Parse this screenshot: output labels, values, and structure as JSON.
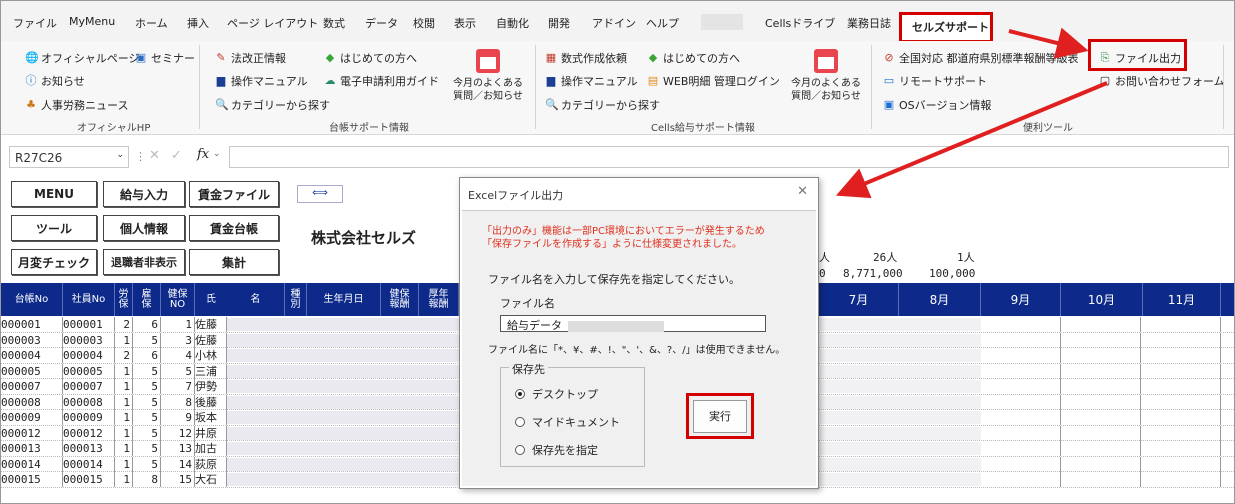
{
  "menu": {
    "tabs": [
      "ファイル",
      "MyMenu",
      "ホーム",
      "挿入",
      "ページ レイアウト",
      "数式",
      "データ",
      "校閲",
      "表示",
      "自動化",
      "開発",
      "アドイン",
      "ヘルプ",
      "Cellsドライブ",
      "業務日誌"
    ],
    "active_tab": "セルズサポート"
  },
  "ribbon": {
    "official": {
      "official_page": "オフィシャルページ",
      "seminar": "セミナー",
      "notice": "お知らせ",
      "hr_news": "人事労務ニュース",
      "group": "オフィシャルHP"
    },
    "ledger": {
      "law_revision": "法改正情報",
      "beginners": "はじめての方へ",
      "manual": "操作マニュアル",
      "e_application": "電子申請利用ガイド",
      "category": "カテゴリーから探す",
      "faq": "今月のよくある\n質問／お知らせ",
      "group": "台帳サポート情報"
    },
    "payroll": {
      "formula_request": "数式作成依頼",
      "beginners": "はじめての方へ",
      "manual": "操作マニュアル",
      "web_login": "WEB明細 管理ログイン",
      "category": "カテゴリーから探す",
      "faq": "今月のよくある\n質問／お知らせ",
      "group": "Cells給与サポート情報"
    },
    "tools": {
      "prefecture_table": "全国対応 都道府県別標準報酬等級表",
      "remote_support": "リモートサポート",
      "os_version": "OSバージョン情報",
      "file_output": "ファイル出力",
      "inquiry": "お問い合わせフォーム",
      "group": "便利ツール"
    }
  },
  "formula_bar": {
    "name_box": "R27C26",
    "fx": "fx"
  },
  "sheet": {
    "buttons": {
      "menu": "MENU",
      "payroll_input": "給与入力",
      "wage_file": "賃金ファイル",
      "tools": "ツール",
      "personal": "個人情報",
      "wage_ledger": "賃金台帳",
      "monthly_check": "月変チェック",
      "hide_retired": "退職者非表示",
      "totals": "集計"
    },
    "company": "株式会社セルズ",
    "stats_row1": [
      "人",
      "26人",
      "1人"
    ],
    "stats_row2": [
      "0",
      "8,771,000",
      "100,000"
    ],
    "headers": {
      "ledger_no": "台帳No",
      "employee_no": "社員No",
      "rou": "労\n保",
      "koyo": "雇\n保",
      "kenpo": "健保\nNO",
      "name_shi": "氏",
      "name_mei": "名",
      "type": "種\n別",
      "birthday": "生年月日",
      "kenpo_pay": "健保\n報酬",
      "kosei_pay": "厚年\n報酬",
      "m7": "7月",
      "m8": "8月",
      "m9": "9月",
      "m10": "10月",
      "m11": "11月"
    },
    "rows": [
      {
        "ledger": "000001",
        "emp": "000001",
        "rou": "2",
        "koyo": "6",
        "kenpo": "1",
        "name": "佐藤"
      },
      {
        "ledger": "000003",
        "emp": "000003",
        "rou": "1",
        "koyo": "5",
        "kenpo": "3",
        "name": "佐藤"
      },
      {
        "ledger": "000004",
        "emp": "000004",
        "rou": "2",
        "koyo": "6",
        "kenpo": "4",
        "name": "小林"
      },
      {
        "ledger": "000005",
        "emp": "000005",
        "rou": "1",
        "koyo": "5",
        "kenpo": "5",
        "name": "三浦"
      },
      {
        "ledger": "000007",
        "emp": "000007",
        "rou": "1",
        "koyo": "5",
        "kenpo": "7",
        "name": "伊勢"
      },
      {
        "ledger": "000008",
        "emp": "000008",
        "rou": "1",
        "koyo": "5",
        "kenpo": "8",
        "name": "後藤"
      },
      {
        "ledger": "000009",
        "emp": "000009",
        "rou": "1",
        "koyo": "5",
        "kenpo": "9",
        "name": "坂本"
      },
      {
        "ledger": "000012",
        "emp": "000012",
        "rou": "1",
        "koyo": "5",
        "kenpo": "12",
        "name": "井原"
      },
      {
        "ledger": "000013",
        "emp": "000013",
        "rou": "1",
        "koyo": "5",
        "kenpo": "13",
        "name": "加古"
      },
      {
        "ledger": "000014",
        "emp": "000014",
        "rou": "1",
        "koyo": "5",
        "kenpo": "14",
        "name": "荻原"
      },
      {
        "ledger": "000015",
        "emp": "000015",
        "rou": "1",
        "koyo": "8",
        "kenpo": "15",
        "name": "大石"
      }
    ]
  },
  "dialog": {
    "title": "Excelファイル出力",
    "close": "✕",
    "warning_line1": "「出力のみ」機能は一部PC環境においてエラーが発生するため",
    "warning_line2": "「保存ファイルを作成する」ように仕様変更されました。",
    "instruction": "ファイル名を入力して保存先を指定してください。",
    "filename_label": "ファイル名",
    "filename_value": "給与データ",
    "invalid_chars_note": "ファイル名に「*、¥、#、!、\"、'、&、?、/」は使用できません。",
    "save_location_label": "保存先",
    "options": [
      "デスクトップ",
      "マイドキュメント",
      "保存先を指定"
    ],
    "selected_option": "デスクトップ",
    "execute": "実行"
  },
  "colors": {
    "header_bg": "#0d2a8a",
    "highlight": "#d40000",
    "warning": "#e0301e"
  }
}
